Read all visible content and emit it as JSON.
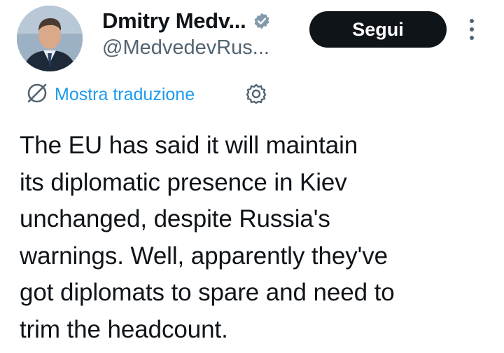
{
  "author": {
    "display_name": "Dmitry Medv...",
    "handle": "@MedvedevRus...",
    "verified": true,
    "avatar_icon": "profile-photo",
    "verified_icon": "verified-badge-icon"
  },
  "actions": {
    "follow_label": "Segui",
    "more_icon": "more-vertical-icon"
  },
  "translation": {
    "label": "Mostra traduzione",
    "translate_icon": "translate-icon",
    "settings_icon": "gear-icon"
  },
  "tweet": {
    "lines": [
      "The EU has said it will maintain",
      "its diplomatic presence in Kiev",
      "unchanged, despite Russia's",
      "warnings. Well, apparently they've",
      "got diplomats to spare and need to",
      "trim the headcount."
    ]
  },
  "colors": {
    "text": "#0f1419",
    "secondary": "#536471",
    "link": "#1d9bf0",
    "button_bg": "#0f1419",
    "button_text": "#ffffff"
  }
}
